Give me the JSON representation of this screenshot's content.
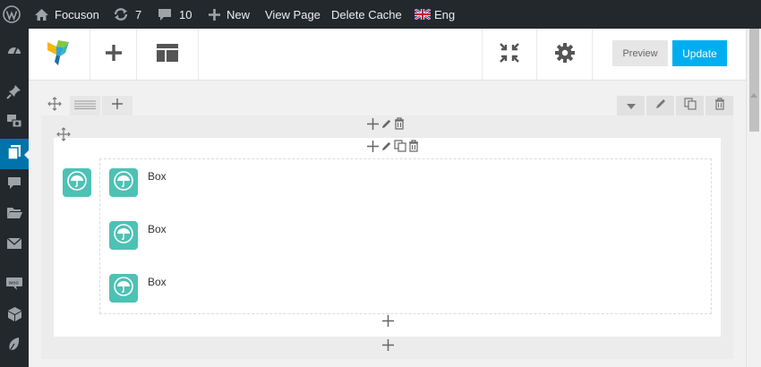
{
  "adminbar": {
    "site_name": "Focuson",
    "updates_count": "7",
    "comments_count": "10",
    "new_label": "New",
    "view_page_label": "View Page",
    "delete_cache_label": "Delete Cache",
    "language_label": "Eng"
  },
  "toolbar": {
    "preview_label": "Preview",
    "update_label": "Update"
  },
  "elements": [
    {
      "label": "Box"
    },
    {
      "label": "Box"
    },
    {
      "label": "Box"
    }
  ],
  "colors": {
    "adminbar_bg": "#23282d",
    "active_menu": "#0073aa",
    "update_button": "#00aeef",
    "box_icon": "#4ec1b5"
  }
}
